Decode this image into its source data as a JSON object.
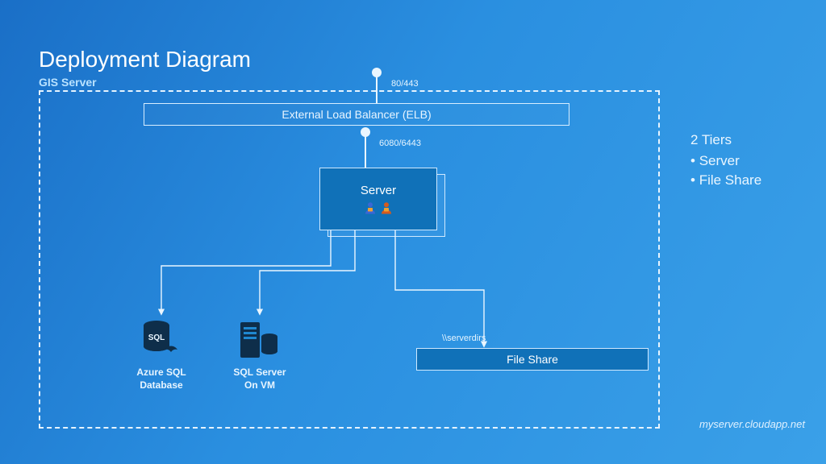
{
  "title": "Deployment Diagram",
  "subtitle": "GIS Server",
  "ports": {
    "external": "80/443",
    "internal": "6080/6443"
  },
  "boxes": {
    "elb": "External Load Balancer (ELB)",
    "server": "Server",
    "fileshare": "File Share"
  },
  "path_label": "\\\\serverdirs",
  "db": {
    "azure_line1": "Azure SQL",
    "azure_line2": "Database",
    "sqlvm_line1": "SQL Server",
    "sqlvm_line2": "On VM",
    "badge": "SQL"
  },
  "right": {
    "heading": "2 Tiers",
    "items": [
      "Server",
      "File Share"
    ]
  },
  "footer": "myserver.cloudapp.net",
  "colors": {
    "accent": "#0e2e4a"
  }
}
